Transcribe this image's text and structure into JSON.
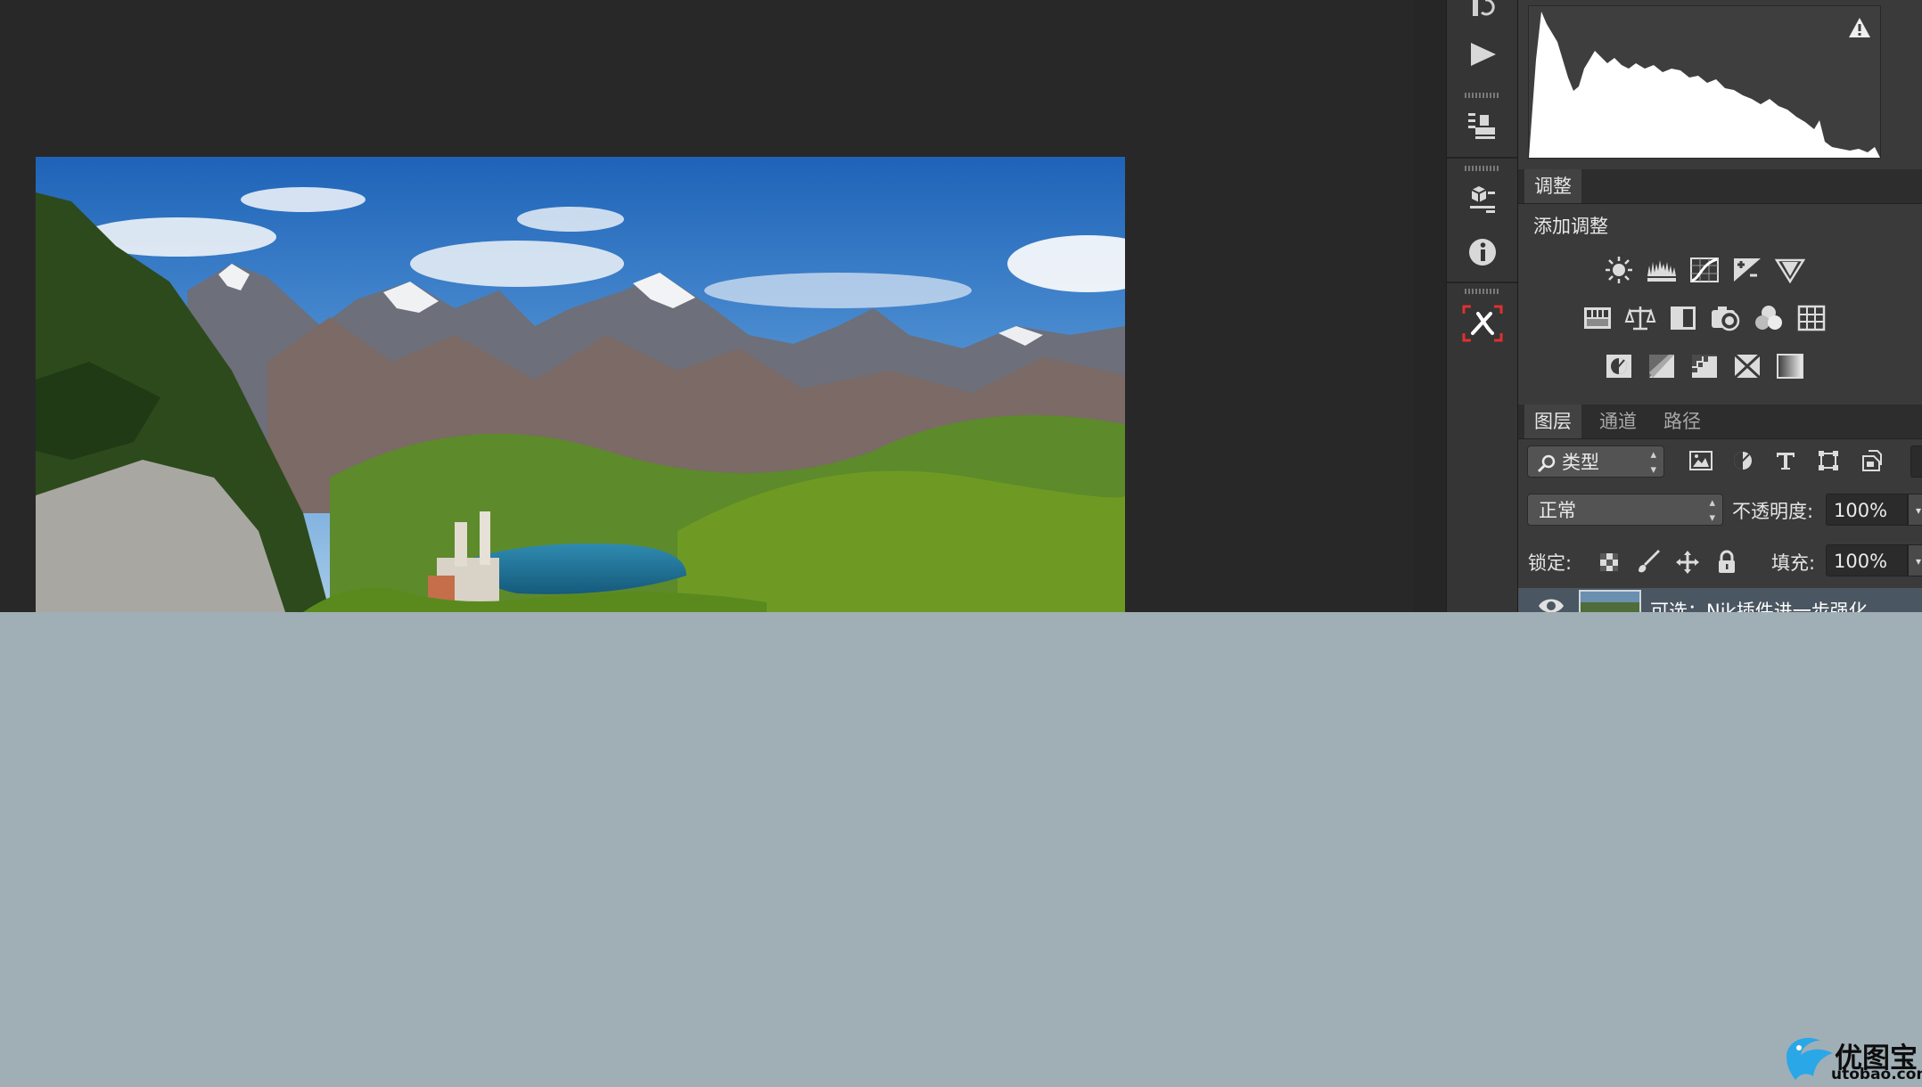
{
  "panels": {
    "adjustments": {
      "tab_label": "调整",
      "title": "添加调整",
      "row1": [
        "brightness-contrast-icon",
        "levels-icon",
        "curves-icon",
        "exposure-icon",
        "vibrance-icon"
      ],
      "row2": [
        "hue-saturation-icon",
        "color-balance-icon",
        "black-white-icon",
        "photo-filter-icon",
        "channel-mixer-icon",
        "color-lookup-icon"
      ],
      "row3": [
        "invert-icon",
        "posterize-icon",
        "threshold-icon",
        "selective-color-icon",
        "gradient-map-icon"
      ]
    },
    "layers": {
      "tabs": [
        "图层",
        "通道",
        "路径"
      ],
      "filter_kind": "类型",
      "blend_mode": "正常",
      "opacity_label": "不透明度:",
      "opacity_value": "100%",
      "lock_label": "锁定:",
      "fill_label": "填充:",
      "fill_value": "100%",
      "layer_name": "可选：Nik插件进一步强化"
    }
  },
  "toolbar": {
    "icons": [
      "history-icon",
      "play-actions-icon",
      "clone-source-icon",
      "3d-properties-icon",
      "info-icon",
      "plugin-x-icon"
    ]
  },
  "watermark": {
    "brand": "优图宝",
    "url": "utobao.com"
  },
  "colors": {
    "app_background": "#282828",
    "panel_background": "#3a3a3a",
    "outer_background": "#a0aeb6",
    "accent_red": "#e03030"
  }
}
